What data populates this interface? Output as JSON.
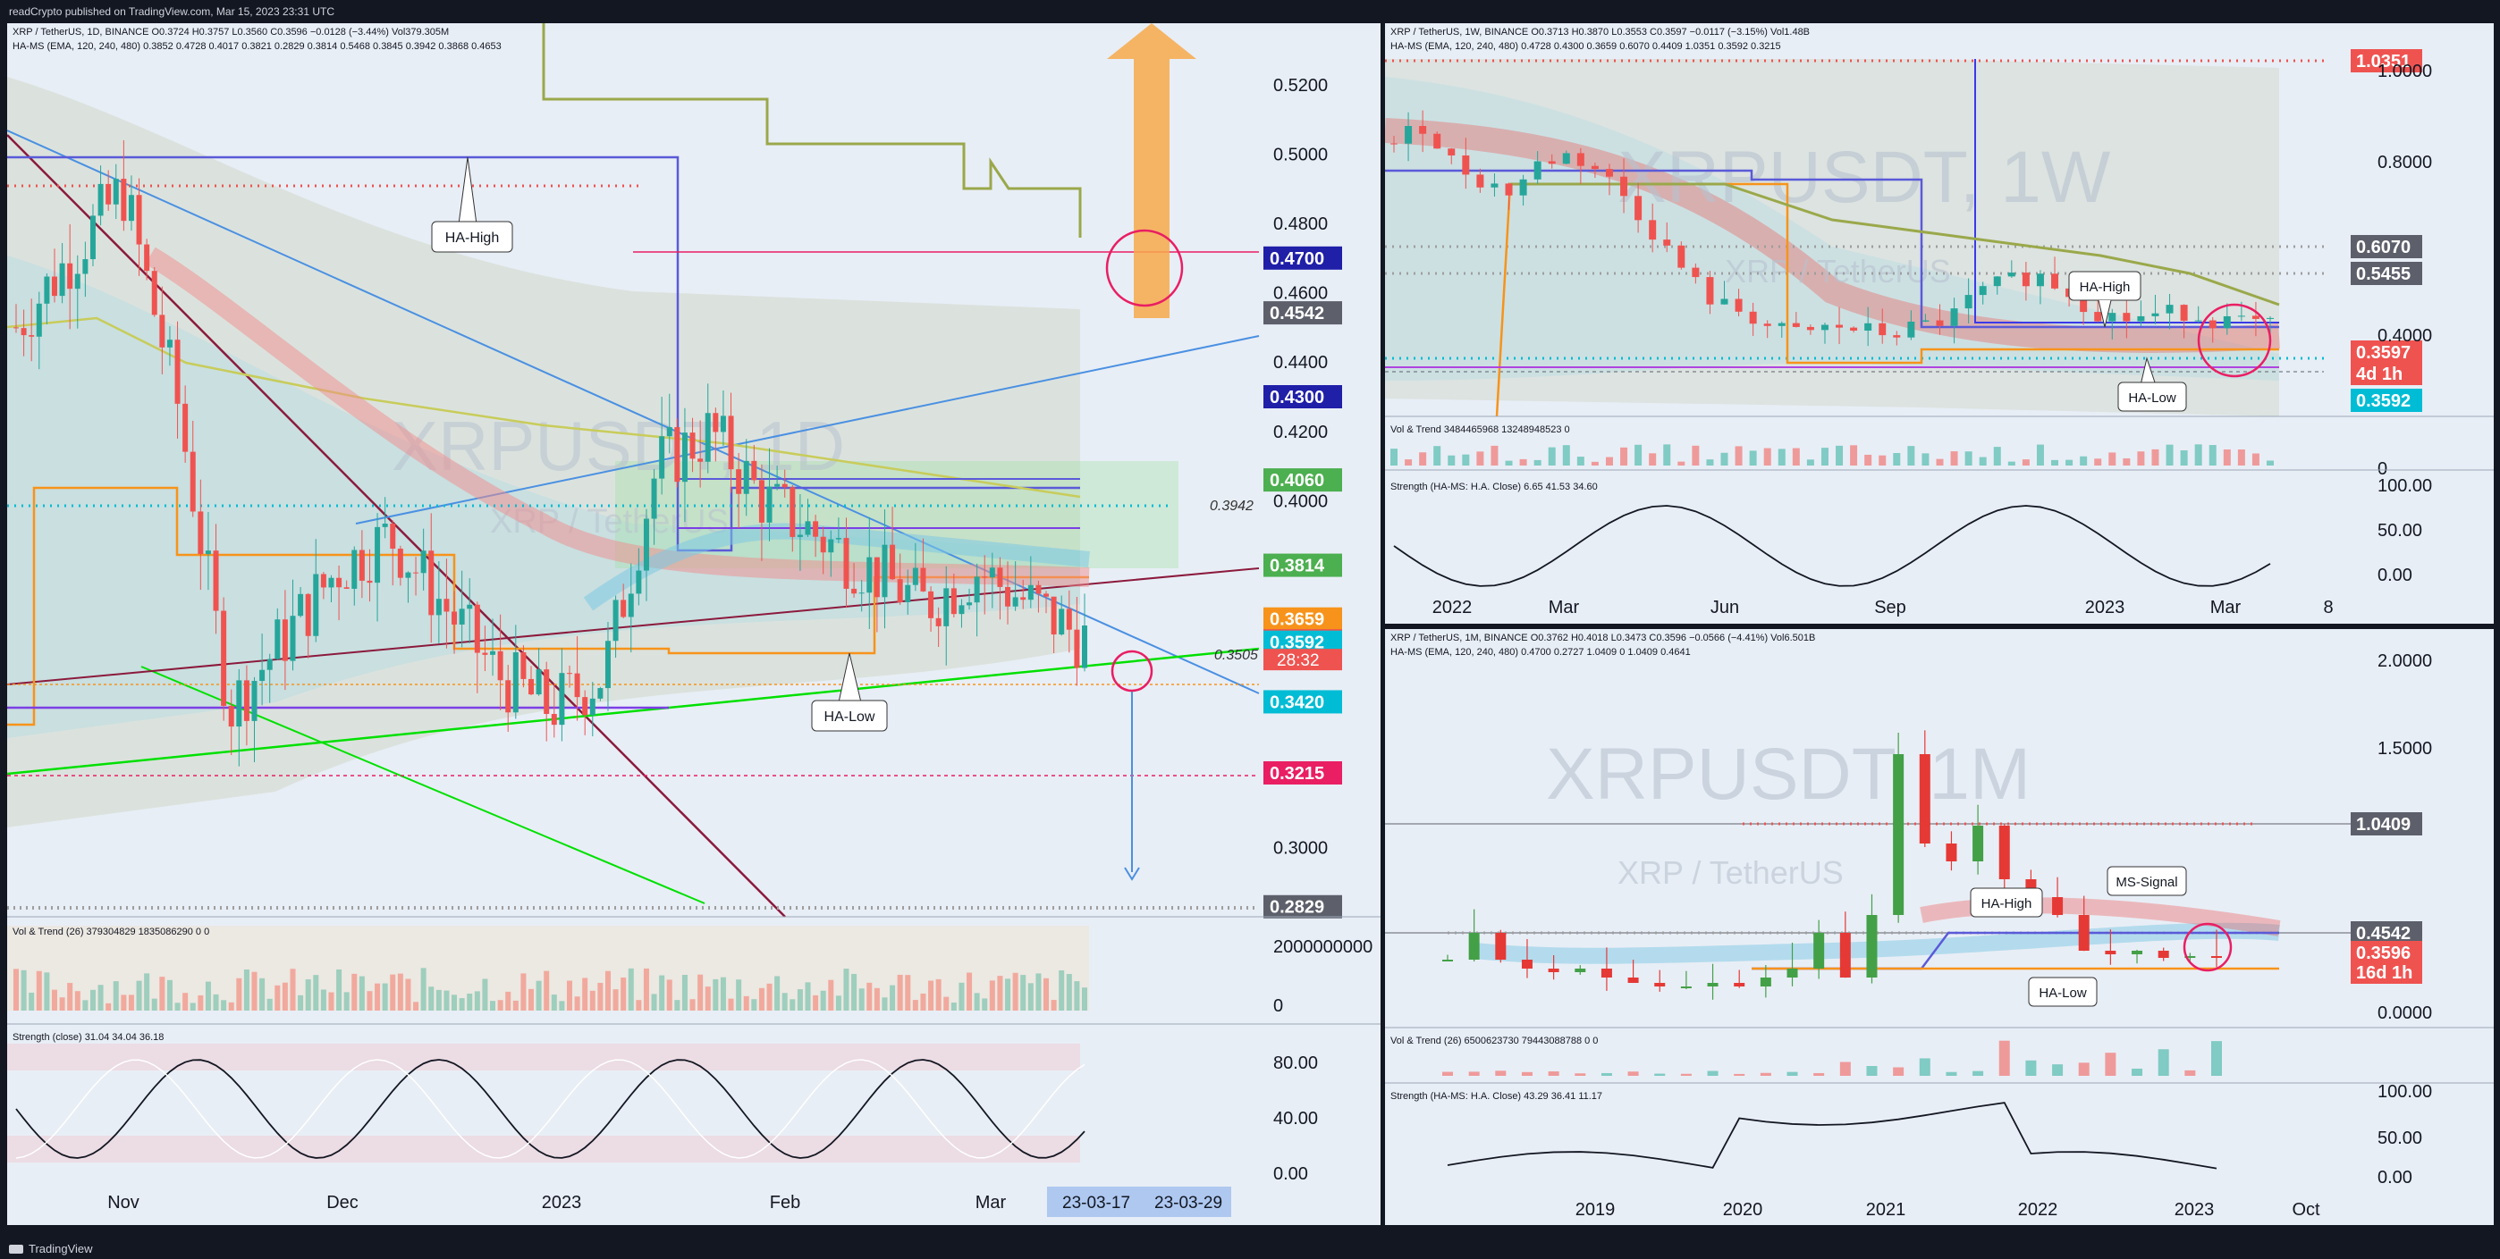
{
  "header": {
    "text": "readCrypto published on TradingView.com, Mar 15, 2023 23:31 UTC"
  },
  "footer": {
    "brand": "TradingView"
  },
  "colors": {
    "bg": "#131722",
    "panel": "#e8eef6",
    "up": "#26a69a",
    "down": "#ef5350",
    "axis": "#131722"
  },
  "daily": {
    "legend1": "XRP / TetherUS, 1D, BINANCE  O0.3724  H0.3757  L0.3560  C0.3596  −0.0128 (−3.44%)  Vol379.305M",
    "legend2": "HA-MS (EMA, 120, 240, 480)  0.3852  0.4728  0.4017  0.3821  0.2829  0.3814  0.5468  0.3845  0.3942  0.3868  0.4653",
    "watermark": "XRPUSDT, 1D",
    "watermark_sub": "XRP / TetherUS",
    "y_ticks": [
      "0.5200",
      "0.5000",
      "0.4800",
      "0.4600",
      "0.4400",
      "0.4200",
      "0.4000",
      "0.3000"
    ],
    "y_ticks_vals": [
      0.52,
      0.5,
      0.48,
      0.46,
      0.44,
      0.42,
      0.4,
      0.3
    ],
    "x_ticks": [
      "Nov",
      "Dec",
      "2023",
      "Feb",
      "Mar"
    ],
    "price_labels": [
      {
        "text": "0.4700",
        "value": 0.47,
        "color": "#1f1fa8"
      },
      {
        "text": "0.4542",
        "value": 0.4542,
        "color": "#5d606b"
      },
      {
        "text": "0.4300",
        "value": 0.43,
        "color": "#1f1fa8"
      },
      {
        "text": "0.4060",
        "value": 0.406,
        "color": "#4caf50"
      },
      {
        "text": "0.3814",
        "value": 0.3814,
        "color": "#4caf50"
      },
      {
        "text": "0.3659",
        "value": 0.3659,
        "color": "#f7931a"
      },
      {
        "text": "0.3596",
        "value": 0.3596,
        "color": "#ef5350"
      },
      {
        "text": "0.3592",
        "value": 0.3592,
        "color": "#00bcd4"
      },
      {
        "text": "0.3420",
        "value": 0.342,
        "color": "#00bcd4"
      },
      {
        "text": "0.3215",
        "value": 0.3215,
        "color": "#e91e63"
      },
      {
        "text": "0.2829",
        "value": 0.2829,
        "color": "#5d606b"
      }
    ],
    "countdown": "28:32",
    "annotations": {
      "ha_high": "HA-High",
      "ha_low": "HA-Low",
      "v1": "0.3942",
      "v2": "0.3505"
    },
    "date_range": [
      "23-03-17",
      "23-03-29"
    ],
    "vol_legend": "Vol & Trend (26)  379304829  1835086290  0  0",
    "vol_ticks": [
      "2000000000",
      "0"
    ],
    "strength_legend": "Strength (close)  31.04  34.04  36.18",
    "strength_ticks": [
      "80.00",
      "40.00",
      "0.00"
    ]
  },
  "weekly": {
    "legend1": "XRP / TetherUS, 1W, BINANCE  O0.3713  H0.3870  L0.3553  C0.3597  −0.0117 (−3.15%)  Vol1.48B",
    "legend2": "HA-MS (EMA, 120, 240, 480)  0.4728  0.4300  0.3659  0.6070  0.4409  1.0351  0.3592  0.3215",
    "watermark": "XRPUSDT, 1W",
    "watermark_sub": "XRP / TetherUS",
    "y_ticks": [
      "1.0000",
      "0.8000",
      "0.4000",
      "0"
    ],
    "x_ticks": [
      "2022",
      "Mar",
      "Jun",
      "Sep",
      "2023",
      "Mar",
      "8"
    ],
    "price_labels": [
      {
        "text": "1.0351",
        "color": "#ef5350"
      },
      {
        "text": "0.6070",
        "color": "#5d606b"
      },
      {
        "text": "0.5455",
        "color": "#5d606b"
      },
      {
        "text": "0.3597",
        "color": "#ef5350"
      },
      {
        "text": "4d 1h",
        "color": "#ef5350"
      },
      {
        "text": "0.3592",
        "color": "#00bcd4"
      }
    ],
    "annotations": {
      "ha_high": "HA-High",
      "ha_low": "HA-Low"
    },
    "vol_legend": "Vol & Trend  3484465968  13248948523  0",
    "strength_legend": "Strength (HA-MS: H.A. Close)  6.65  41.53  34.60",
    "strength_ticks": [
      "100.00",
      "50.00",
      "0.00"
    ]
  },
  "monthly": {
    "legend1": "XRP / TetherUS, 1M, BINANCE  O0.3762  H0.4018  L0.3473  C0.3596  −0.0566 (−4.41%)  Vol6.501B",
    "legend2": "HA-MS (EMA, 120, 240, 480)  0.4700  0.2727  1.0409  0  1.0409  0.4641",
    "watermark": "XRPUSDT, 1M",
    "watermark_sub": "XRP / TetherUS",
    "y_ticks": [
      "2.0000",
      "1.5000",
      "0.0000"
    ],
    "x_ticks": [
      "2019",
      "2020",
      "2021",
      "2022",
      "2023",
      "Oct"
    ],
    "price_labels": [
      {
        "text": "1.0409",
        "color": "#5d606b"
      },
      {
        "text": "0.4542",
        "color": "#5d606b"
      },
      {
        "text": "0.3596",
        "color": "#ef5350"
      },
      {
        "text": "16d 1h",
        "color": "#ef5350"
      }
    ],
    "annotations": {
      "ha_high": "HA-High",
      "ha_low": "HA-Low",
      "ms_signal": "MS-Signal"
    },
    "vol_legend": "Vol & Trend (26)  6500623730  79443088788  0  0",
    "strength_legend": "Strength (HA-MS: H.A. Close)  43.29  36.41  11.17",
    "strength_ticks": [
      "100.00",
      "50.00",
      "0.00"
    ]
  },
  "chart_data": [
    {
      "type": "candlestick",
      "title": "XRP / TetherUS, 1D, BINANCE",
      "x": [
        "Nov",
        "Dec",
        "2023",
        "Feb",
        "Mar"
      ],
      "ylim": [
        0.28,
        0.53
      ],
      "last": {
        "open": 0.3724,
        "high": 0.3757,
        "low": 0.356,
        "close": 0.3596
      },
      "close_approx": [
        0.45,
        0.47,
        0.49,
        0.43,
        0.34,
        0.36,
        0.38,
        0.39,
        0.37,
        0.35,
        0.34,
        0.35,
        0.41,
        0.42,
        0.4,
        0.39,
        0.38,
        0.37,
        0.38,
        0.37,
        0.36
      ],
      "levels": [
        0.47,
        0.4542,
        0.43,
        0.406,
        0.3814,
        0.3659,
        0.3596,
        0.3592,
        0.342,
        0.3215,
        0.2829
      ]
    },
    {
      "type": "candlestick",
      "title": "XRP / TetherUS, 1W, BINANCE",
      "x": [
        "2022",
        "Mar",
        "Jun",
        "Sep",
        "2023",
        "Mar",
        "8"
      ],
      "ylim": [
        0,
        1.1
      ],
      "last": {
        "open": 0.3713,
        "high": 0.387,
        "low": 0.3553,
        "close": 0.3597
      },
      "levels": [
        1.0351,
        0.607,
        0.5455,
        0.3597,
        0.3592
      ]
    },
    {
      "type": "candlestick",
      "title": "XRP / TetherUS, 1M, BINANCE",
      "x": [
        "2019",
        "2020",
        "2021",
        "2022",
        "2023",
        "Oct"
      ],
      "ylim": [
        0,
        2.1
      ],
      "last": {
        "open": 0.3762,
        "high": 0.4018,
        "low": 0.3473,
        "close": 0.3596
      },
      "levels": [
        1.0409,
        0.4542,
        0.3596
      ]
    }
  ]
}
